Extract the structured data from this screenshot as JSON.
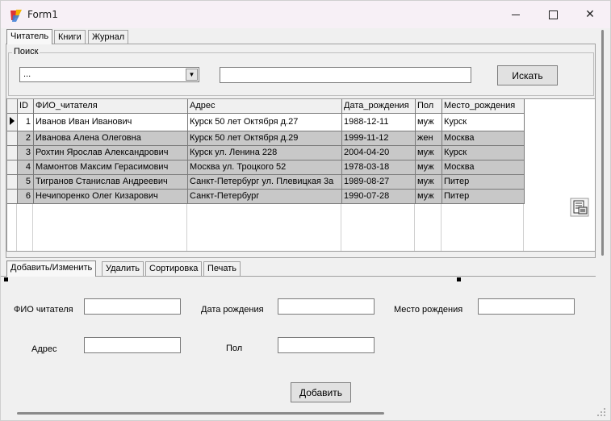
{
  "window": {
    "title": "Form1"
  },
  "top_tabs": [
    {
      "label": "Читатель",
      "active": true
    },
    {
      "label": "Книги",
      "active": false
    },
    {
      "label": "Журнал",
      "active": false
    }
  ],
  "search": {
    "group_label": "Поиск",
    "combo_value": "...",
    "text_value": "",
    "button_label": "Искать"
  },
  "grid": {
    "columns": [
      "ID",
      "ФИО_читателя",
      "Адрес",
      "Дата_рождения",
      "Пол",
      "Место_рождения"
    ],
    "rows": [
      [
        "1",
        "Иванов Иван Иванович",
        "Курск 50 лет Октября д.27",
        "1988-12-11",
        "муж",
        "Курск"
      ],
      [
        "2",
        "Иванова Алена Олеговна",
        "Курск 50 лет Октября д.29",
        "1999-11-12",
        "жен",
        "Москва"
      ],
      [
        "3",
        "Рохтин Ярослав Александрович",
        "Курск ул. Ленина 228",
        "2004-04-20",
        "муж",
        "Курск"
      ],
      [
        "4",
        "Мамонтов Максим Герасимович",
        "Москва ул. Троцкого 52",
        "1978-03-18",
        "муж",
        "Москва"
      ],
      [
        "5",
        "Тигранов Станислав Андреевич",
        "Санкт-Петербург ул. Плевицкая 3а",
        "1989-08-27",
        "муж",
        "Питер"
      ],
      [
        "6",
        "Нечипоренко Олег Кизарович",
        "Санкт-Петербург",
        "1990-07-28",
        "муж",
        "Питер"
      ]
    ]
  },
  "bottom_tabs": [
    {
      "label": "Добавить/Изменить",
      "active": true
    },
    {
      "label": "Удалить",
      "active": false
    },
    {
      "label": "Сортировка",
      "active": false
    },
    {
      "label": "Печать",
      "active": false
    }
  ],
  "form": {
    "fio_label": "ФИО читателя",
    "birthdate_label": "Дата рождения",
    "birthplace_label": "Место рождения",
    "address_label": "Адрес",
    "sex_label": "Пол",
    "add_button": "Добавить"
  }
}
